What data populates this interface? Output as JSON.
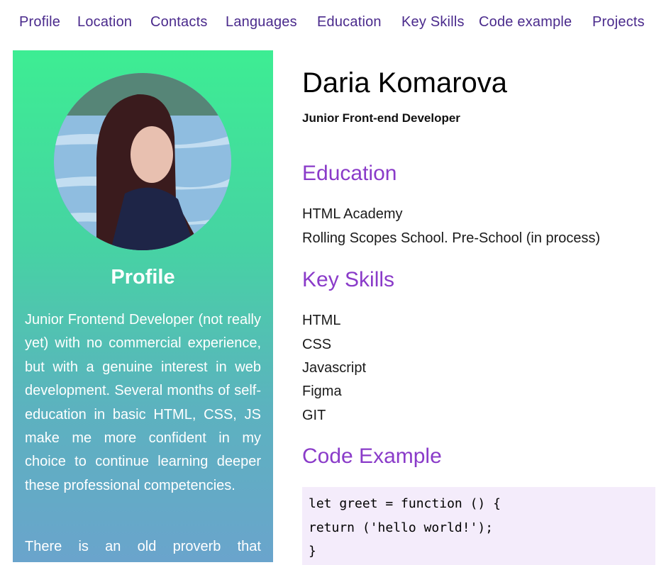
{
  "nav": {
    "items": [
      "Profile",
      "Location",
      "Contacts",
      "Languages",
      "Education",
      "Key Skills",
      "Code example",
      "Projects"
    ]
  },
  "sidebar": {
    "title": "Profile",
    "text1": "Junior Frontend Developer (not really yet) with no commercial experience, but with a genuine interest in web development. Several months of self-education in basic HTML, CSS, JS make me more confident in my choice to continue learning deeper these professional competencies.",
    "text2": "There is an old proverb that"
  },
  "main": {
    "name": "Daria Komarova",
    "role": "Junior Front-end Developer",
    "education": {
      "title": "Education",
      "items": [
        "HTML Academy",
        "Rolling Scopes School. Pre-School (in process)"
      ]
    },
    "skills": {
      "title": "Key Skills",
      "items": [
        "HTML",
        "CSS",
        "Javascript",
        "Figma",
        "GIT"
      ]
    },
    "code": {
      "title": "Code Example",
      "lines": [
        "let greet = function () {",
        "return ('hello world!');",
        "}"
      ]
    }
  },
  "colors": {
    "nav": "#4a2a8c",
    "heading": "#8a3bc9",
    "sidebar_top": "#3ded93",
    "sidebar_bottom": "#6aa4cc",
    "code_bg": "#f4ecfb"
  }
}
